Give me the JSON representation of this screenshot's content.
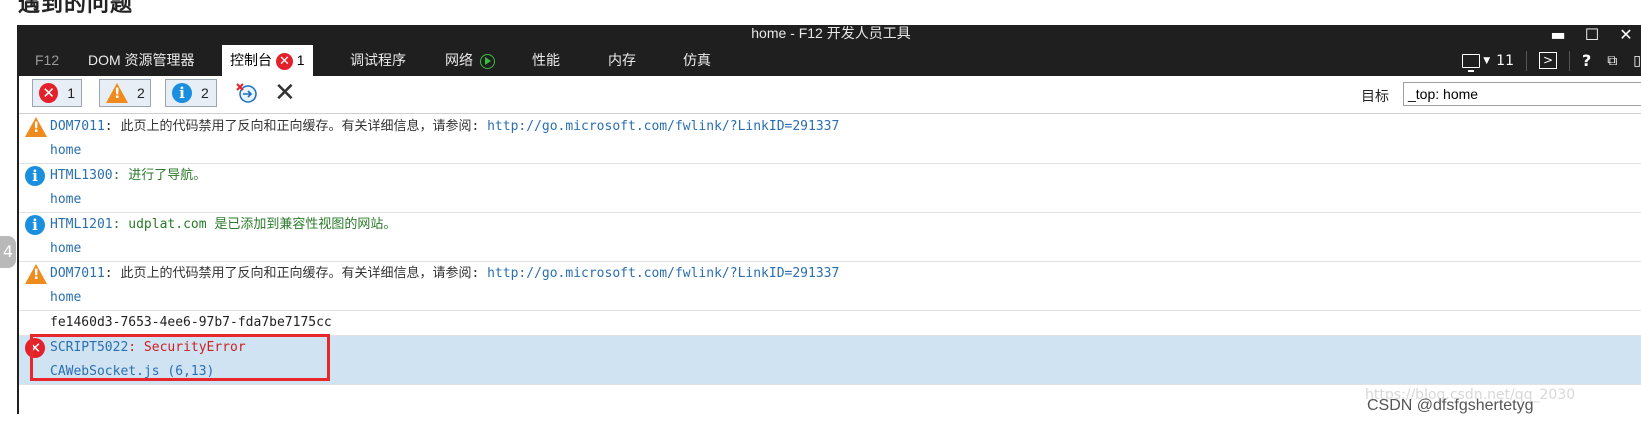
{
  "page": {
    "heading": "遇到的问题",
    "side_tab": "4",
    "watermark": "https://blog.csdn.net/qq_2030",
    "credit": "CSDN @dfsfgshertetyg"
  },
  "window": {
    "title": "home - F12 开发人员工具",
    "minimize": "▬",
    "maximize": "☐",
    "close": "✕"
  },
  "tabs": {
    "f12": "F12",
    "dom": "DOM 资源管理器",
    "console": "控制台",
    "console_errors": "1",
    "debugger": "调试程序",
    "network": "网络",
    "performance": "性能",
    "memory": "内存",
    "emulation": "仿真"
  },
  "tabbar_right": {
    "doc_mode": "11",
    "help": "?"
  },
  "toolbar": {
    "errors_count": "1",
    "warnings_count": "2",
    "info_count": "2",
    "clear_label": "✕",
    "target_label": "目标",
    "target_value": "_top: home"
  },
  "messages": [
    {
      "type": "warning",
      "code": "DOM7011",
      "text": ": 此页上的代码禁用了反向和正向缓存。有关详细信息，请参阅: ",
      "link": "http://go.microsoft.com/fwlink/?LinkID=291337",
      "source": "home"
    },
    {
      "type": "info",
      "code": "HTML1300",
      "text": ": 进行了导航。",
      "link": "",
      "source": "home"
    },
    {
      "type": "info",
      "code": "HTML1201",
      "text": ": udplat.com 是已添加到兼容性视图的网站。",
      "link": "",
      "source": "home"
    },
    {
      "type": "warning",
      "code": "DOM7011",
      "text": ": 此页上的代码禁用了反向和正向缓存。有关详细信息，请参阅: ",
      "link": "http://go.microsoft.com/fwlink/?LinkID=291337",
      "source": "home"
    },
    {
      "type": "log",
      "text": "fe1460d3-7653-4ee6-97b7-fda7be7175cc"
    },
    {
      "type": "error",
      "code": "SCRIPT5022",
      "text": ": SecurityError",
      "source": "CAWebSocket.js (6,13)"
    }
  ],
  "colors": {
    "error": "#e3212b",
    "warning": "#ef8b1c",
    "info": "#1a8fe0",
    "highlight": "#e8262b",
    "selected_row": "#cfe3f3"
  }
}
